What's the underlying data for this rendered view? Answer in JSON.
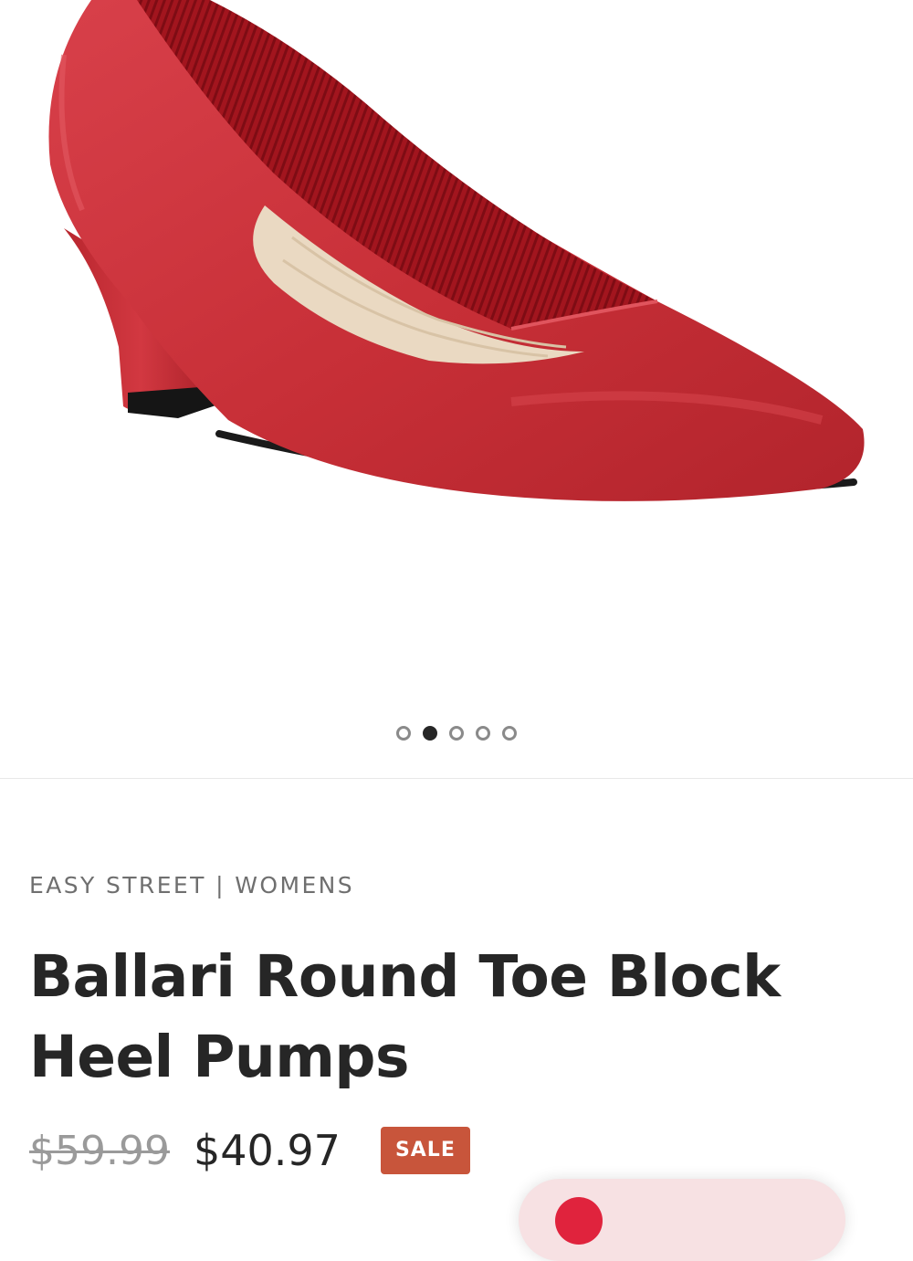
{
  "product": {
    "image_alt": "Red round toe block heel pump",
    "brand_line": "EASY STREET | WOMENS",
    "title": "Ballari Round Toe Block Heel Pumps",
    "price_original": "$59.99",
    "price_sale": "$40.97",
    "sale_badge": "SALE"
  },
  "gallery": {
    "image_count": 5,
    "active_index": 1
  },
  "share_button": {
    "icon": "pink-circle-icon"
  },
  "colors": {
    "shoe": "#c72f37",
    "sale_badge": "#c8553b",
    "share_pill": "#f7e1e3",
    "share_dot": "#e0233d"
  }
}
